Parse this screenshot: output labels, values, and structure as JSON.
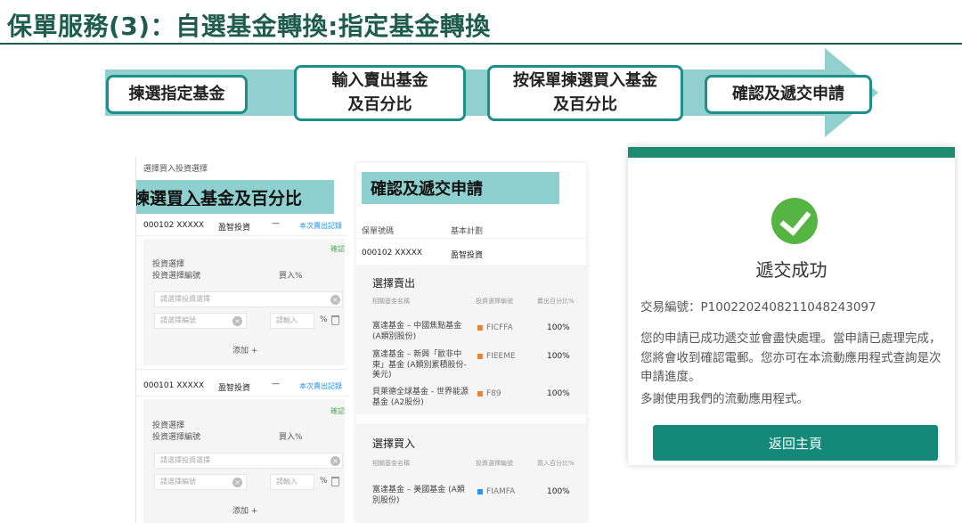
{
  "title": "保單服務(3)：自選基金轉換:指定基金轉換",
  "steps": [
    {
      "label": "揀選指定基金"
    },
    {
      "label": "輸入賣出基金\n及百分比"
    },
    {
      "label": "按保單揀選買入基金\n及百分比"
    },
    {
      "label": "確認及遞交申請"
    }
  ],
  "colors": {
    "title": "#1e5d4e",
    "arrow": "#92cfcf",
    "step_border": "#1c8f8a",
    "primary": "#14897a",
    "success": "#55b543"
  },
  "panel1": {
    "header": "選擇買入投資選擇",
    "tag_prefix": "揀選",
    "tag_underlined": "買入",
    "tag_suffix": "基金及百分比",
    "blocks": [
      {
        "policy": "000102 XXXXX",
        "plan": "盈智投資",
        "dash": "—",
        "record": "本次賣出記錄",
        "done": "確認",
        "sel_label": "投資選擇",
        "code_label": "投資選擇編號",
        "buy_pct_label": "買入%",
        "select_placeholder": "請選擇投資選擇",
        "code_placeholder": "請選擇編號",
        "pct_placeholder": "請輸入",
        "pct_unit": "%",
        "add": "添加 +"
      },
      {
        "policy": "000101 XXXXX",
        "plan": "盈智投資",
        "dash": "—",
        "record": "本次賣出記錄",
        "done": "確認",
        "sel_label": "投資選擇",
        "code_label": "投資選擇編號",
        "buy_pct_label": "買入%",
        "select_placeholder": "請選擇投資選擇",
        "code_placeholder": "請選擇編號",
        "pct_placeholder": "請輸入",
        "pct_unit": "%",
        "add": "添加 +"
      }
    ]
  },
  "panel2": {
    "tag": "確認及遞交申請",
    "policy_label": "保單號碼",
    "plan_label": "基本計劃",
    "policy_no": "000102 XXXXX",
    "plan_name": "盈智投資",
    "sell_title": "選擇賣出",
    "buy_title": "選擇買入",
    "headers": {
      "fund": "相關基金名稱",
      "code": "投資選擇編號",
      "sell_pct": "賣出百分比%",
      "buy_pct": "買入百分比%"
    },
    "sell_rows": [
      {
        "fund": "富達基金 – 中國焦點基金(A類別股份)",
        "code": "FICFFA",
        "pct": "100%",
        "color": "#f08030"
      },
      {
        "fund": "富達基金 – 新興「歐非中東」基金 (A類別累積股份-美元)",
        "code": "FIEEME",
        "pct": "100%",
        "color": "#f08030"
      },
      {
        "fund": "貝萊德全球基金 - 世界能源基金 (A2股份)",
        "code": "F89",
        "pct": "100%",
        "color": "#f08030"
      }
    ],
    "buy_rows": [
      {
        "fund": "富達基金 – 美國基金 (A類別股份)",
        "code": "FIAMFA",
        "pct": "100%",
        "color": "#2196f3"
      }
    ]
  },
  "panel3": {
    "status": "遞交成功",
    "txn": "交易編號：P100220240821104824​3097",
    "message": "您的申請已成功遞交並會盡快處理。當申請已處理完成，您將會收到確認電郵。您亦可在本流動應用程式查詢是次申請進度。",
    "thanks": "多謝使用我們的流動應用程式。",
    "button": "返回主頁"
  }
}
